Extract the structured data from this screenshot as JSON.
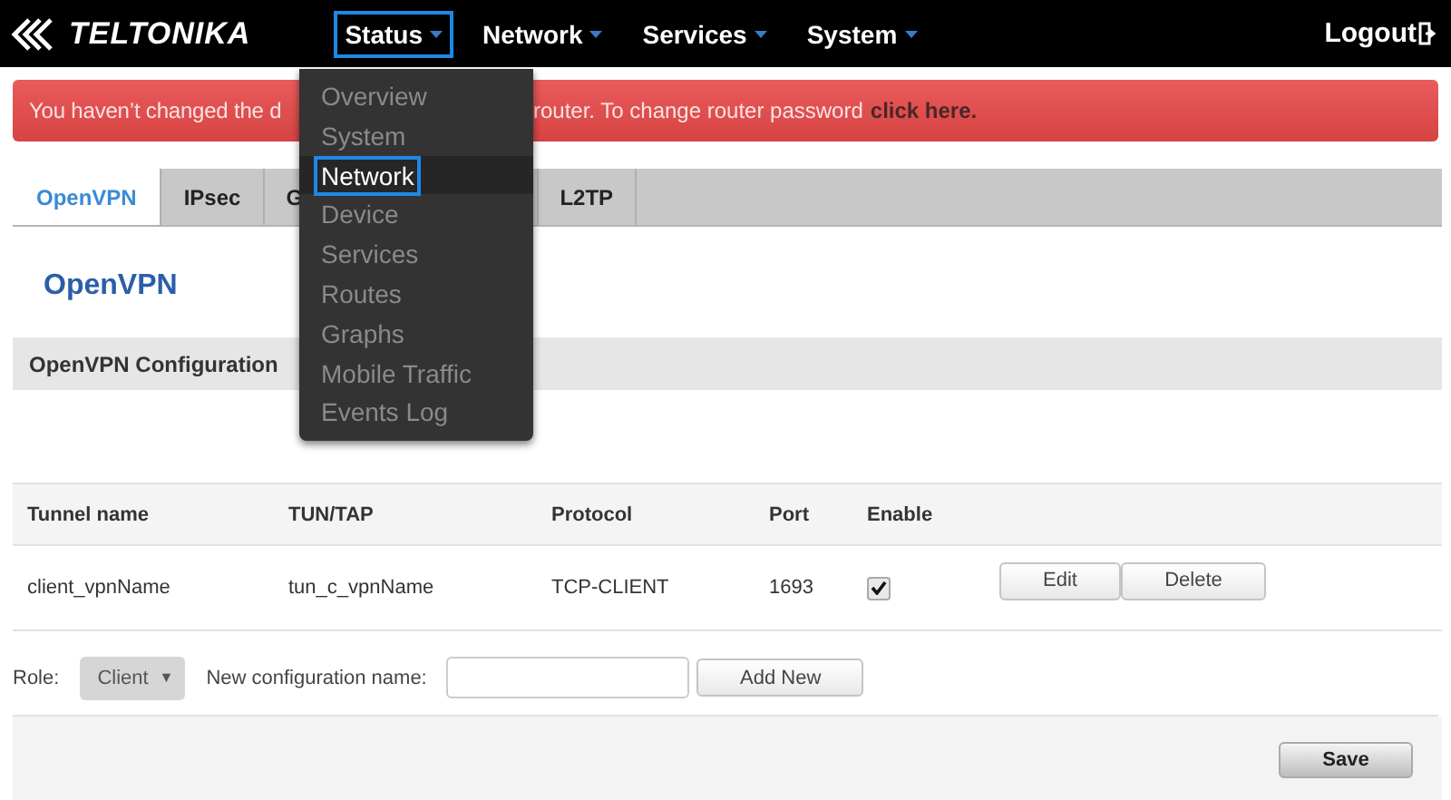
{
  "brand": "TELTONIKA",
  "nav": [
    {
      "label": "Status",
      "selected": true
    },
    {
      "label": "Network",
      "selected": false
    },
    {
      "label": "Services",
      "selected": false
    },
    {
      "label": "System",
      "selected": false
    }
  ],
  "logout": "Logout",
  "status_menu": [
    {
      "label": "Overview",
      "selected": false
    },
    {
      "label": "System",
      "selected": false
    },
    {
      "label": "Network",
      "selected": true
    },
    {
      "label": "Device",
      "selected": false
    },
    {
      "label": "Services",
      "selected": false
    },
    {
      "label": "Routes",
      "selected": false
    },
    {
      "label": "Graphs",
      "selected": false
    },
    {
      "label": "Mobile Traffic",
      "selected": false
    },
    {
      "label": "Events Log",
      "selected": false
    }
  ],
  "alert": {
    "text_start": "You haven’t changed the d",
    "text_end": "router. To change router password",
    "link": "click here."
  },
  "tabs": [
    {
      "label": "OpenVPN",
      "selected": true
    },
    {
      "label": "IPsec",
      "selected": false
    },
    {
      "label": "G",
      "selected": false
    },
    {
      "label": "L2TP",
      "selected": false
    }
  ],
  "page_title": "OpenVPN",
  "section_title": "OpenVPN Configuration",
  "table": {
    "columns": [
      "Tunnel name",
      "TUN/TAP",
      "Protocol",
      "Port",
      "Enable"
    ],
    "rows": [
      {
        "tunnel_name": "client_vpnName",
        "tun_tap": "tun_c_vpnName",
        "protocol": "TCP-CLIENT",
        "port": "1693",
        "enabled": true,
        "actions": [
          "Edit",
          "Delete"
        ]
      }
    ]
  },
  "add_form": {
    "role_label": "Role:",
    "role_value": "Client",
    "role_caret": "▼",
    "name_label": "New configuration name:",
    "add_button": "Add New"
  },
  "save_button": "Save"
}
